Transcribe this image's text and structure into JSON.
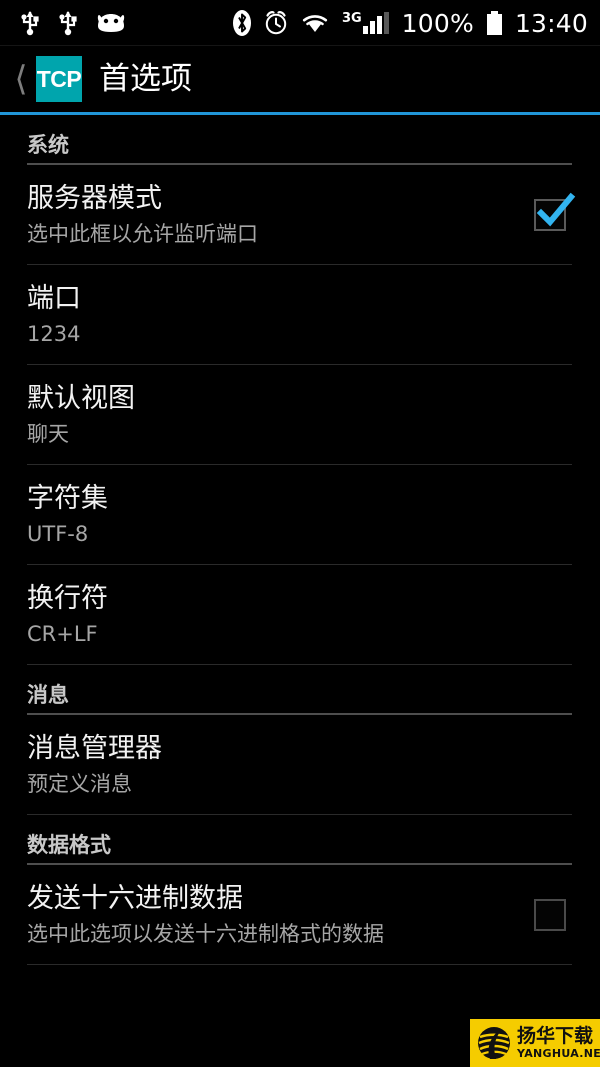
{
  "statusbar": {
    "left_icons": [
      "usb-icon",
      "usb-icon",
      "android-head-icon"
    ],
    "right_icons": [
      "bluetooth-icon",
      "alarm-clock-icon",
      "wifi-icon",
      "signal-bars-icon",
      "battery-icon"
    ],
    "network_type": "3G",
    "battery_percent": "100%",
    "time": "13:40"
  },
  "actionbar": {
    "back_icon": "back-chevron-icon",
    "app_icon_label": "TCP",
    "title": "首选项",
    "accent_color": "#2196d8",
    "app_icon_color": "#00a5ad"
  },
  "sections": [
    {
      "header": "系统",
      "rows": [
        {
          "title": "服务器模式",
          "summary": "选中此框以允许监听端口",
          "control": "checkbox",
          "checked": true
        },
        {
          "title": "端口",
          "summary": "1234",
          "control": "none",
          "checked": false
        },
        {
          "title": "默认视图",
          "summary": "聊天",
          "control": "none",
          "checked": false
        },
        {
          "title": "字符集",
          "summary": "UTF-8",
          "control": "none",
          "checked": false
        },
        {
          "title": "换行符",
          "summary": "CR+LF",
          "control": "none",
          "checked": false
        }
      ]
    },
    {
      "header": "消息",
      "rows": [
        {
          "title": "消息管理器",
          "summary": "预定义消息",
          "control": "none",
          "checked": false
        }
      ]
    },
    {
      "header": "数据格式",
      "rows": [
        {
          "title": "发送十六进制数据",
          "summary": "选中此选项以发送十六进制格式的数据",
          "control": "checkbox",
          "checked": false
        }
      ]
    }
  ],
  "watermark": {
    "cn": "扬华下载",
    "en": "YANGHUA.NET",
    "icon": "globe-icon",
    "background": "#f5cc00"
  }
}
